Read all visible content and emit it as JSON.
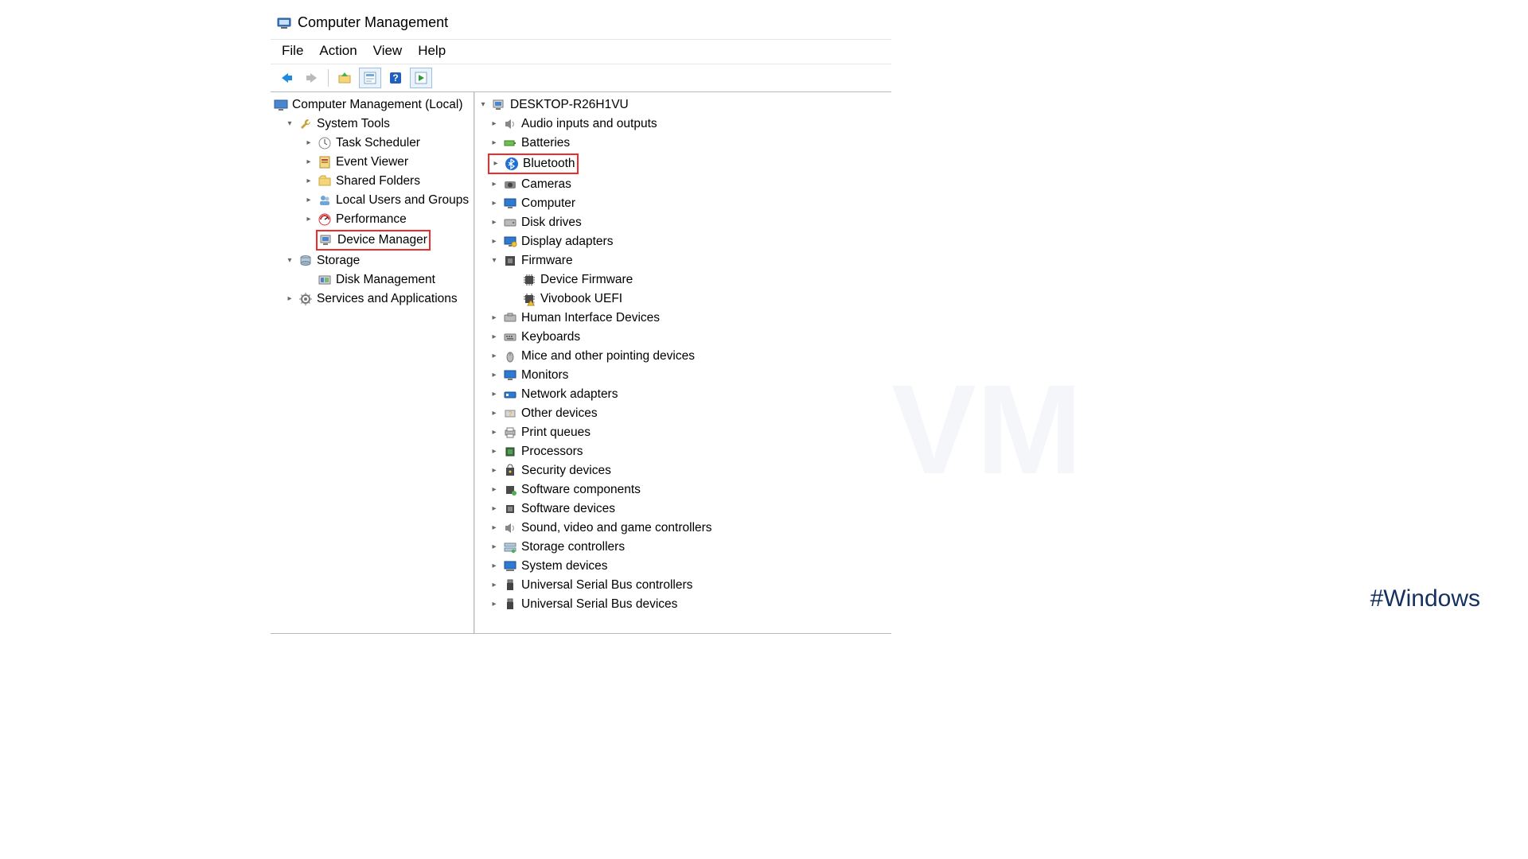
{
  "watermark": "NeuronVM",
  "hashtag": "#Windows",
  "window": {
    "title": "Computer Management",
    "menus": [
      "File",
      "Action",
      "View",
      "Help"
    ],
    "toolbar": {
      "back": "back-arrow",
      "forward": "forward-arrow",
      "up": "up-folder",
      "props": "properties",
      "help": "help",
      "refresh": "refresh"
    }
  },
  "leftTree": {
    "root": "Computer Management (Local)",
    "systemTools": {
      "label": "System Tools",
      "taskScheduler": "Task Scheduler",
      "eventViewer": "Event Viewer",
      "sharedFolders": "Shared Folders",
      "localUsers": "Local Users and Groups",
      "performance": "Performance",
      "deviceManager": "Device Manager"
    },
    "storage": {
      "label": "Storage",
      "diskManagement": "Disk Management"
    },
    "services": "Services and Applications"
  },
  "rightTree": {
    "root": "DESKTOP-R26H1VU",
    "items": [
      {
        "label": "Audio inputs and outputs",
        "icon": "speaker"
      },
      {
        "label": "Batteries",
        "icon": "battery"
      },
      {
        "label": "Bluetooth",
        "icon": "bluetooth",
        "highlight": true
      },
      {
        "label": "Cameras",
        "icon": "camera"
      },
      {
        "label": "Computer",
        "icon": "monitor"
      },
      {
        "label": "Disk drives",
        "icon": "disk"
      },
      {
        "label": "Display adapters",
        "icon": "display"
      },
      {
        "label": "Firmware",
        "icon": "firmware",
        "expanded": true,
        "children": [
          {
            "label": "Device Firmware",
            "icon": "chip"
          },
          {
            "label": "Vivobook UEFI",
            "icon": "chip-warn"
          }
        ]
      },
      {
        "label": "Human Interface Devices",
        "icon": "hid"
      },
      {
        "label": "Keyboards",
        "icon": "keyboard"
      },
      {
        "label": "Mice and other pointing devices",
        "icon": "mouse"
      },
      {
        "label": "Monitors",
        "icon": "monitor"
      },
      {
        "label": "Network adapters",
        "icon": "network"
      },
      {
        "label": "Other devices",
        "icon": "other"
      },
      {
        "label": "Print queues",
        "icon": "printer"
      },
      {
        "label": "Processors",
        "icon": "cpu"
      },
      {
        "label": "Security devices",
        "icon": "security"
      },
      {
        "label": "Software components",
        "icon": "component"
      },
      {
        "label": "Software devices",
        "icon": "swdev"
      },
      {
        "label": "Sound, video and game controllers",
        "icon": "speaker"
      },
      {
        "label": "Storage controllers",
        "icon": "storagectrl"
      },
      {
        "label": "System devices",
        "icon": "system"
      },
      {
        "label": "Universal Serial Bus controllers",
        "icon": "usb"
      },
      {
        "label": "Universal Serial Bus devices",
        "icon": "usb"
      }
    ]
  }
}
